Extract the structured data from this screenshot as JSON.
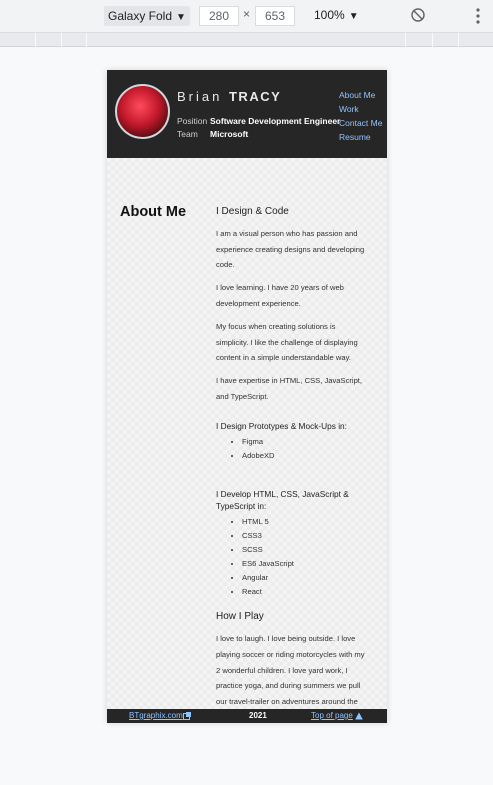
{
  "devtools": {
    "device": "Galaxy Fold",
    "width": "280",
    "height": "653",
    "times": "×",
    "zoom": "100%",
    "caret": "▼"
  },
  "header": {
    "first_name": "Brian",
    "last_name": "TRACY",
    "position_label": "Position",
    "position_value": "Software Development Engineer",
    "team_label": "Team",
    "team_value": "Microsoft",
    "nav": [
      "About Me",
      "Work",
      "Contact Me",
      "Resume"
    ]
  },
  "about": {
    "heading": "About Me",
    "design_title": "I Design & Code",
    "paragraphs": [
      "I am a visual person who has passion and experience creating designs and developing code.",
      "I love learning. I have 20 years of web development experience.",
      "My focus when creating solutions is simplicity. I like the challenge of displaying content in a simple understandable way.",
      "I have expertise in HTML, CSS, JavaScript, and TypeScript."
    ],
    "prototypes_title": "I Design Prototypes & Mock-Ups in:",
    "prototypes_items": [
      "Figma",
      "AdobeXD"
    ],
    "develop_title": "I Develop HTML, CSS, JavaScript & TypeScript in:",
    "develop_items": [
      "HTML 5",
      "CSS3",
      "SCSS",
      "ES6 JavaScript",
      "Angular",
      "React"
    ],
    "play_title": "How I Play",
    "play_paragraph": "I love to laugh. I love being outside. I love playing soccer or riding motorcycles with my 2 wonderful children. I love yard work, I practice yoga, and during summers we pull our travel-trailer on adventures around the Pacific Northwest. In my free time, I love to sketch and paint."
  },
  "footer": {
    "site_link": "BTgraphix.com",
    "year": "2021",
    "top_link": "Top of page"
  },
  "colors": {
    "header_bg": "#262626",
    "link": "#8fc4ff"
  }
}
